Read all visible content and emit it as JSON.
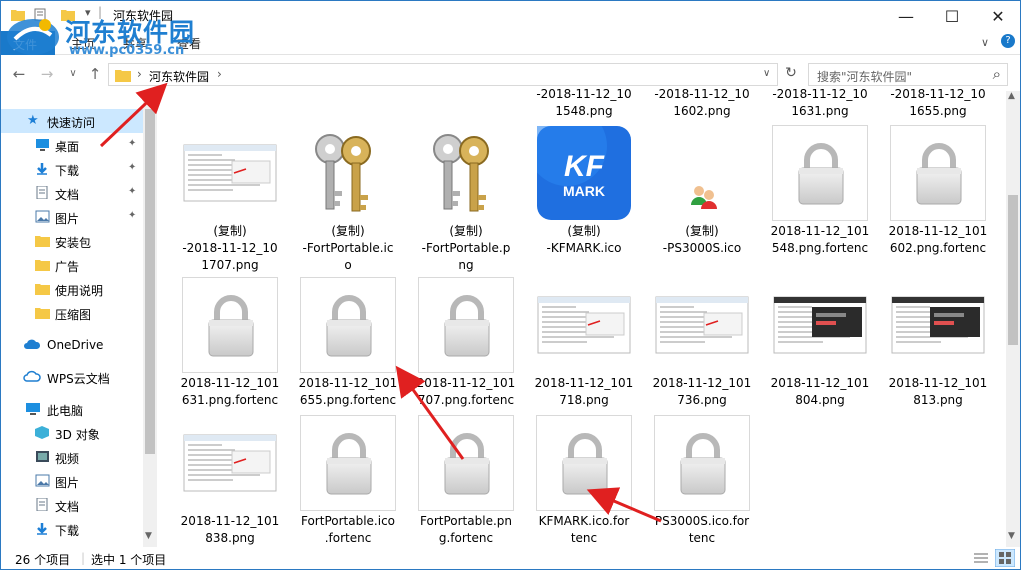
{
  "window": {
    "title": "河东软件园",
    "controls": {
      "minimize": "—",
      "maximize": "☐",
      "close": "✕"
    }
  },
  "watermark": {
    "name": "河东软件园",
    "url": "www.pc0359.cn"
  },
  "ribbon": {
    "file_tab": "文件",
    "tabs": [
      "主页",
      "共享",
      "查看"
    ],
    "collapse": "∨",
    "help": "?"
  },
  "nav": {
    "back": "←",
    "forward": "→",
    "recent": "∨",
    "up": "↑",
    "breadcrumb": "河东软件园",
    "dropdown": "∨",
    "refresh": "↻",
    "search_placeholder": "搜索\"河东软件园\"",
    "search_icon": "⌕"
  },
  "sidebar": {
    "quick_access": "快速访问",
    "items": [
      {
        "label": "桌面",
        "pinned": true,
        "icon": "desktop-icon"
      },
      {
        "label": "下载",
        "pinned": true,
        "icon": "download-icon"
      },
      {
        "label": "文档",
        "pinned": true,
        "icon": "document-icon"
      },
      {
        "label": "图片",
        "pinned": true,
        "icon": "picture-icon"
      },
      {
        "label": "安装包",
        "pinned": false,
        "icon": "folder-icon"
      },
      {
        "label": "广告",
        "pinned": false,
        "icon": "folder-icon"
      },
      {
        "label": "使用说明",
        "pinned": false,
        "icon": "folder-icon"
      },
      {
        "label": "压缩图",
        "pinned": false,
        "icon": "folder-icon"
      }
    ],
    "onedrive": "OneDrive",
    "wps": "WPS云文档",
    "this_pc": "此电脑",
    "pc_items": [
      {
        "label": "3D 对象",
        "icon": "3d-objects-icon"
      },
      {
        "label": "视频",
        "icon": "video-icon"
      },
      {
        "label": "图片",
        "icon": "picture-icon"
      },
      {
        "label": "文档",
        "icon": "document-icon"
      },
      {
        "label": "下载",
        "icon": "download-icon"
      }
    ]
  },
  "files": {
    "top_partial": [
      {
        "line1": "-2018-11-12_10",
        "line2": "1548.png"
      },
      {
        "line1": "-2018-11-12_10",
        "line2": "1602.png"
      },
      {
        "line1": "-2018-11-12_10",
        "line2": "1631.png"
      },
      {
        "line1": "-2018-11-12_10",
        "line2": "1655.png"
      }
    ],
    "rows": [
      [
        {
          "kind": "screenshot",
          "l1": "(复制)",
          "l2": "-2018-11-12_10",
          "l3": "1707.png"
        },
        {
          "kind": "keys",
          "l1": "(复制)",
          "l2": "-FortPortable.ic",
          "l3": "o"
        },
        {
          "kind": "keys",
          "l1": "(复制)",
          "l2": "-FortPortable.p",
          "l3": "ng"
        },
        {
          "kind": "kfmark",
          "l1": "(复制)",
          "l2": "-KFMARK.ico",
          "l3": ""
        },
        {
          "kind": "people",
          "l1": "(复制)",
          "l2": "-PS3000S.ico",
          "l3": ""
        },
        {
          "kind": "lock",
          "l1": "2018-11-12_101",
          "l2": "548.png.fortenc",
          "l3": ""
        },
        {
          "kind": "lock",
          "l1": "2018-11-12_101",
          "l2": "602.png.fortenc",
          "l3": ""
        }
      ],
      [
        {
          "kind": "lock",
          "l1": "2018-11-12_101",
          "l2": "631.png.fortenc",
          "l3": ""
        },
        {
          "kind": "lock",
          "l1": "2018-11-12_101",
          "l2": "655.png.fortenc",
          "l3": ""
        },
        {
          "kind": "lock",
          "l1": "2018-11-12_101",
          "l2": "707.png.fortenc",
          "l3": ""
        },
        {
          "kind": "screenshot",
          "l1": "2018-11-12_101",
          "l2": "718.png",
          "l3": ""
        },
        {
          "kind": "screenshot",
          "l1": "2018-11-12_101",
          "l2": "736.png",
          "l3": ""
        },
        {
          "kind": "darkshot",
          "l1": "2018-11-12_101",
          "l2": "804.png",
          "l3": ""
        },
        {
          "kind": "darkshot",
          "l1": "2018-11-12_101",
          "l2": "813.png",
          "l3": ""
        }
      ],
      [
        {
          "kind": "screenshot",
          "l1": "2018-11-12_101",
          "l2": "838.png",
          "l3": ""
        },
        {
          "kind": "lock",
          "l1": "FortPortable.ico",
          "l2": ".fortenc",
          "l3": ""
        },
        {
          "kind": "lock",
          "l1": "FortPortable.pn",
          "l2": "g.fortenc",
          "l3": ""
        },
        {
          "kind": "lock",
          "l1": "KFMARK.ico.for",
          "l2": "tenc",
          "l3": ""
        },
        {
          "kind": "lock",
          "l1": "PS3000S.ico.for",
          "l2": "tenc",
          "l3": ""
        }
      ]
    ],
    "kfmark_text": [
      "KF",
      "MARK"
    ]
  },
  "status": {
    "count": "26 个项目",
    "selected": "选中 1 个项目"
  },
  "colors": {
    "accent": "#1979ca",
    "selection": "#cce8ff",
    "arrow": "#e02020",
    "folder": "#f5c846"
  }
}
